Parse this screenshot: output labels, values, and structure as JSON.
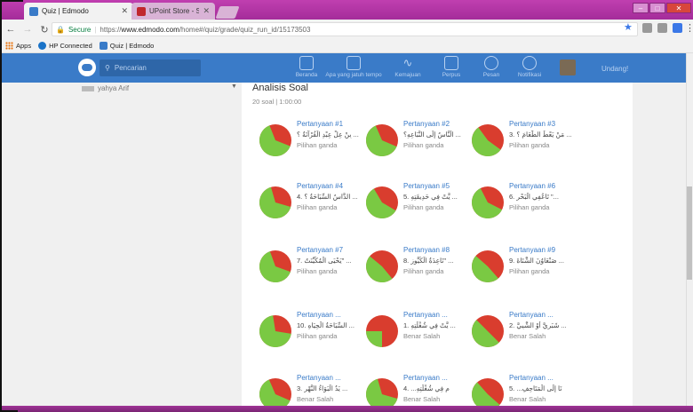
{
  "browser": {
    "tabs": [
      {
        "label": "Quiz | Edmodo",
        "active": true
      },
      {
        "label": "UPoint Store - Steam Pa",
        "active": false
      }
    ],
    "secure_label": "Secure",
    "url_prefix": "https://",
    "url_host": "www.edmodo.com",
    "url_path": "/home#/quiz/grade/quiz_run_id/15173503",
    "bookmarks": [
      {
        "label": "Apps"
      },
      {
        "label": "HP Connected"
      },
      {
        "label": "Quiz | Edmodo"
      }
    ]
  },
  "header": {
    "search_placeholder": "Pencarian",
    "nav": [
      {
        "label": "Beranda",
        "icon": "home-icon"
      },
      {
        "label": "Apa yang jatuh tempo",
        "icon": "calendar-icon"
      },
      {
        "label": "Kemajuan",
        "icon": "progress-icon"
      },
      {
        "label": "Perpus",
        "icon": "library-icon"
      },
      {
        "label": "Pesan",
        "icon": "message-icon"
      },
      {
        "label": "Notifikasi",
        "icon": "bell-icon"
      }
    ],
    "invite_label": "Undang!"
  },
  "sidebar": {
    "partial_label": "yahya Arif"
  },
  "main": {
    "title": "Analisis Soal",
    "subtitle": "20 soal | 1:00:00",
    "questions": [
      {
        "title": "Pertanyaan #1",
        "text": "بِنْ عِلْ عِبْدِ الْقُرْآنَةُ ؟ ...",
        "type": "Pilihan ganda",
        "correct": 0.63
      },
      {
        "title": "Pertanyaan #2",
        "text": "الْنَّاسُ إِلَى النَّبَاعِهِ؟ ...",
        "type": "Pilihan ganda",
        "correct": 0.62
      },
      {
        "title": "Pertanyaan #3",
        "text": "3. مَنْ يَعْطُ الطَّعَامَ ؟ ...",
        "type": "Pilihan ganda",
        "correct": 0.55
      },
      {
        "title": "Pertanyaan #4",
        "text": "4. الدَّاسُ السِّبَاحَةُ ؟ ...",
        "type": "Pilihan ganda",
        "correct": 0.66
      },
      {
        "title": "Pertanyaan #5",
        "text": "5. يَّتْ فِي حَدِيقَتِهِ ...",
        "type": "Pilihan ganda",
        "correct": 0.58
      },
      {
        "title": "Pertanyaan #6",
        "text": "6. تَاعُفِي الْبَحْرِ \"...",
        "type": "Pilihan ganda",
        "correct": 0.6
      },
      {
        "title": "Pertanyaan #7",
        "text": "7. يَحْيَى الْمُكَيِّنَتُ\" ...",
        "type": "Pilihan ganda",
        "correct": 0.64
      },
      {
        "title": "Pertanyaan #8",
        "text": "8. نَاعِدَةُ الْكَيُّوزِ\" ...",
        "type": "Pilihan ganda",
        "correct": 0.47
      },
      {
        "title": "Pertanyaan #9",
        "text": "9. صَنْعَاوُنَ الشَّتَاةَ ...",
        "type": "Pilihan ganda",
        "correct": 0.48
      },
      {
        "title": "Pertanyaan ...",
        "text": "10. السِّبَاحَةُ الْحِيَاهِ ...",
        "type": "Pilihan ganda",
        "correct": 0.7
      },
      {
        "title": "Pertanyaan ...",
        "text": "1. يَّتْ فِي شُغْلَتِهِ ...",
        "type": "Benar Salah",
        "correct": 0.25
      },
      {
        "title": "Pertanyaan ...",
        "text": "2. شَبَرِيَّ أَوْ الشَّبِيَّ ...",
        "type": "Benar Salah",
        "correct": 0.5
      },
      {
        "title": "Pertanyaan ...",
        "text": "3. يَدُ الْبَوَاءُ النَّهْرِ ...",
        "type": "Benar Salah",
        "correct": 0.62
      },
      {
        "title": "Pertanyaan ...",
        "text": "4. ...م فِي شُغْلَتِهِ",
        "type": "Benar Salah",
        "correct": 0.66
      },
      {
        "title": "Pertanyaan ...",
        "text": "5. ...نَا إِلَى الْمَتَاحِفِ",
        "type": "Benar Salah",
        "correct": 0.52
      }
    ]
  },
  "colors": {
    "correct": "#7ac943",
    "incorrect": "#d93d2e",
    "header": "#3a7bc8",
    "link": "#3a7bc8"
  }
}
